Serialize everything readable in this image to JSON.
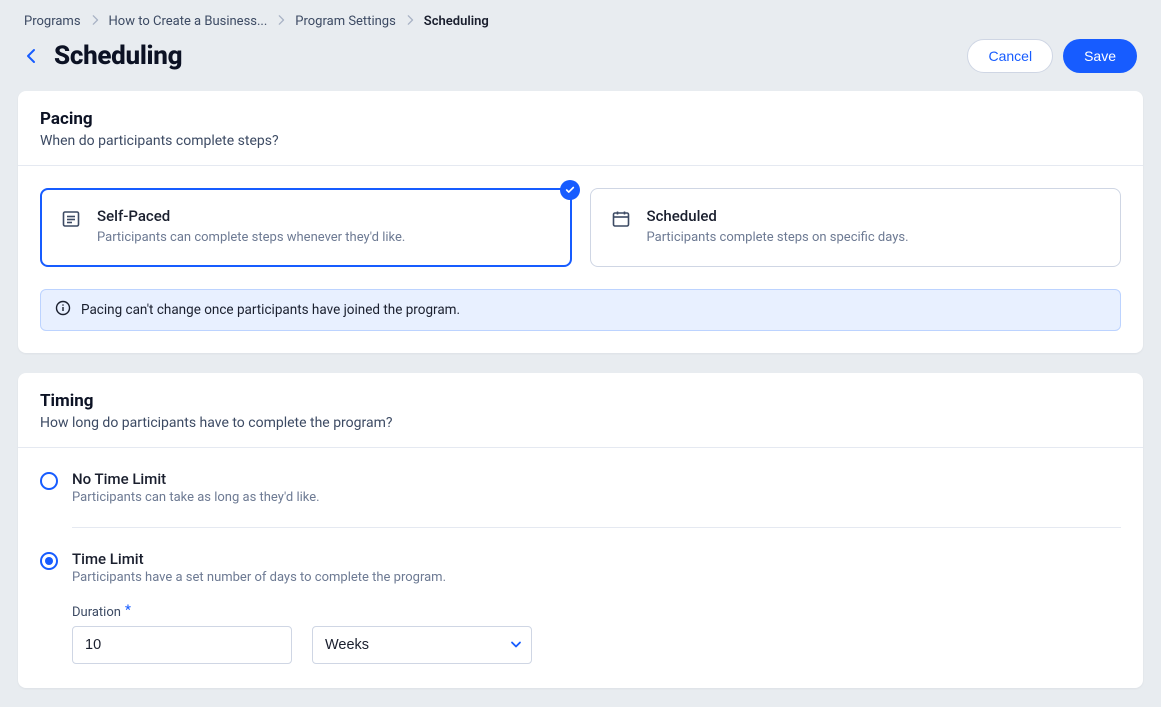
{
  "breadcrumb": {
    "items": [
      "Programs",
      "How to Create a Business...",
      "Program Settings"
    ],
    "current": "Scheduling"
  },
  "header": {
    "title": "Scheduling",
    "cancel": "Cancel",
    "save": "Save"
  },
  "pacing": {
    "title": "Pacing",
    "subtitle": "When do participants complete steps?",
    "options": [
      {
        "title": "Self-Paced",
        "desc": "Participants can complete steps whenever they'd like.",
        "selected": true
      },
      {
        "title": "Scheduled",
        "desc": "Participants complete steps on specific days.",
        "selected": false
      }
    ],
    "info": "Pacing can't change once participants have joined the program."
  },
  "timing": {
    "title": "Timing",
    "subtitle": "How long do participants have to complete the program?",
    "no_limit": {
      "title": "No Time Limit",
      "desc": "Participants can take as long as they'd like."
    },
    "time_limit": {
      "title": "Time Limit",
      "desc": "Participants have a set number of days to complete the program.",
      "duration_label": "Duration",
      "duration_value": "10",
      "unit_value": "Weeks"
    }
  }
}
